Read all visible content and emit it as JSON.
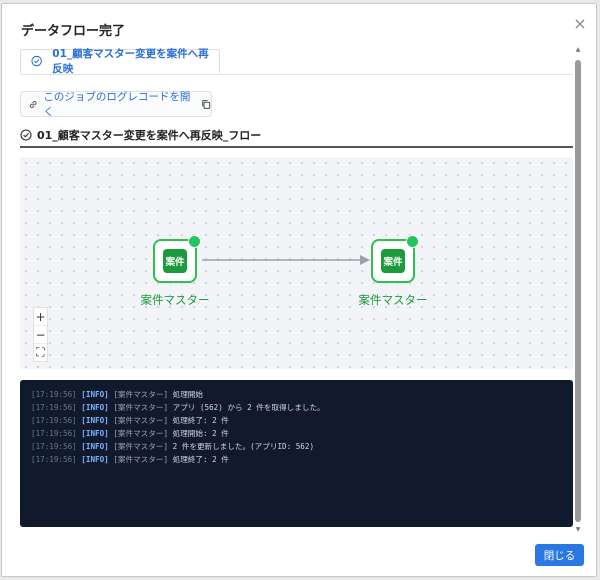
{
  "dialog": {
    "title": "データフロー完了",
    "close_symbol": "×"
  },
  "tab": {
    "label": "01_顧客マスター変更を案件へ再反映"
  },
  "joblink": {
    "label": "このジョブのログレコードを開く"
  },
  "flow": {
    "title": "01_顧客マスター変更を案件へ再反映_フロー"
  },
  "nodes": [
    {
      "badge": "案件",
      "label": "案件マスター",
      "status": "done"
    },
    {
      "badge": "案件",
      "label": "案件マスター",
      "status": "done"
    }
  ],
  "zoom": {
    "in": "+",
    "out": "−",
    "fit": "⛶"
  },
  "log": [
    {
      "time": "[17:19:56]",
      "level": "[INFO]",
      "source": "[案件マスター]",
      "message": "処理開始"
    },
    {
      "time": "[17:19:56]",
      "level": "[INFO]",
      "source": "[案件マスター]",
      "message": "アプリ (562) から 2 件を取得しました。"
    },
    {
      "time": "[17:19:56]",
      "level": "[INFO]",
      "source": "[案件マスター]",
      "message": "処理終了: 2 件"
    },
    {
      "time": "[17:19:56]",
      "level": "[INFO]",
      "source": "[案件マスター]",
      "message": "処理開始: 2 件"
    },
    {
      "time": "[17:19:56]",
      "level": "[INFO]",
      "source": "[案件マスター]",
      "message": "2 件を更新しました。(アプリID: 562)"
    },
    {
      "time": "[17:19:56]",
      "level": "[INFO]",
      "source": "[案件マスター]",
      "message": "処理終了: 2 件"
    }
  ],
  "footer": {
    "close_label": "閉じる"
  },
  "colors": {
    "accent": "#2a79e3",
    "node_green": "#1d9a3c",
    "status_green": "#22c55e",
    "log_bg": "#111a2c"
  },
  "icons": {
    "tab": "check-circle-icon",
    "link": "link-icon",
    "copy": "copy-icon",
    "flow": "check-circle-icon"
  }
}
